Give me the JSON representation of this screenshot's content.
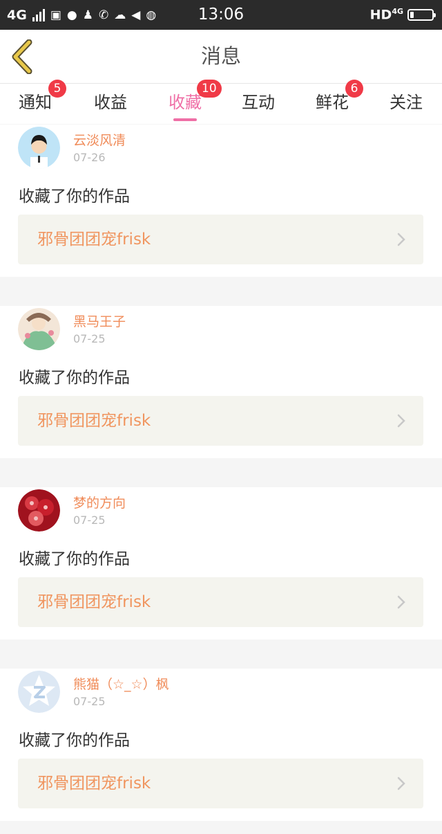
{
  "status_bar": {
    "network": "4G",
    "time": "13:06",
    "hd_label": "HD",
    "hd_network": "4G",
    "battery_level": 0.15
  },
  "header": {
    "title": "消息"
  },
  "tabs": [
    {
      "label": "通知",
      "badge": "5",
      "active": false
    },
    {
      "label": "收益",
      "badge": "",
      "active": false
    },
    {
      "label": "收藏",
      "badge": "10",
      "active": true
    },
    {
      "label": "互动",
      "badge": "",
      "active": false
    },
    {
      "label": "鲜花",
      "badge": "6",
      "active": false
    },
    {
      "label": "关注",
      "badge": "",
      "active": false
    }
  ],
  "messages": [
    {
      "username": "云淡风清",
      "date": "07-26",
      "text": "收藏了你的作品",
      "work_title": "邪骨团团宠frisk",
      "avatar_icon": "cartoon-boy-avatar"
    },
    {
      "username": "黑马王子",
      "date": "07-25",
      "text": "收藏了你的作品",
      "work_title": "邪骨团团宠frisk",
      "avatar_icon": "anime-character-avatar"
    },
    {
      "username": "梦的方向",
      "date": "07-25",
      "text": "收藏了你的作品",
      "work_title": "邪骨团团宠frisk",
      "avatar_icon": "red-flowers-avatar"
    },
    {
      "username": "熊猫（☆_☆）枫",
      "date": "07-25",
      "text": "收藏了你的作品",
      "work_title": "邪骨团团宠frisk",
      "avatar_icon": "default-star-avatar"
    }
  ],
  "colors": {
    "accent_pink": "#ef6fa6",
    "badge_red": "#f03a47",
    "username_orange": "#f08c5a",
    "back_arrow": "#e8c84a"
  }
}
